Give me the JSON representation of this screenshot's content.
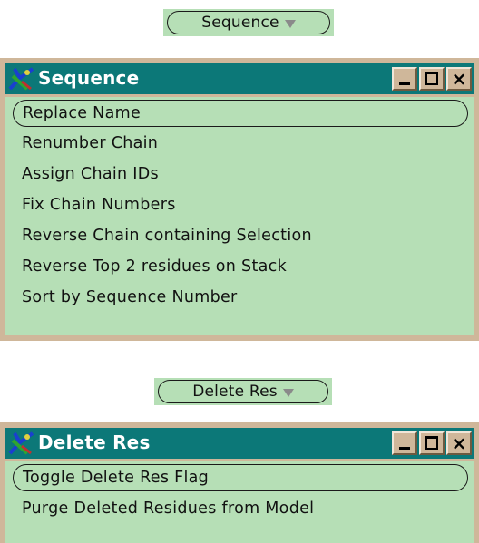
{
  "sequence_button": {
    "label": "Sequence"
  },
  "sequence_window": {
    "title": "Sequence",
    "items": [
      {
        "label": "Replace Name"
      },
      {
        "label": "Renumber Chain"
      },
      {
        "label": "Assign Chain IDs"
      },
      {
        "label": "Fix Chain Numbers"
      },
      {
        "label": "Reverse Chain containing Selection"
      },
      {
        "label": "Reverse Top 2 residues on Stack"
      },
      {
        "label": "Sort by Sequence Number"
      }
    ]
  },
  "delete_button": {
    "label": "Delete Res"
  },
  "delete_window": {
    "title": "Delete Res",
    "items": [
      {
        "label": "Toggle Delete Res Flag"
      },
      {
        "label": "Purge Deleted Residues from Model"
      }
    ]
  },
  "window_controls": {
    "close_glyph": "×"
  },
  "colors": {
    "menu_bg": "#b6dfb6",
    "titlebar": "#0c7878",
    "frame": "#cfb79a"
  },
  "icons": [
    "app-icon",
    "chevron-down-icon",
    "minimize-icon",
    "maximize-icon",
    "close-icon"
  ]
}
